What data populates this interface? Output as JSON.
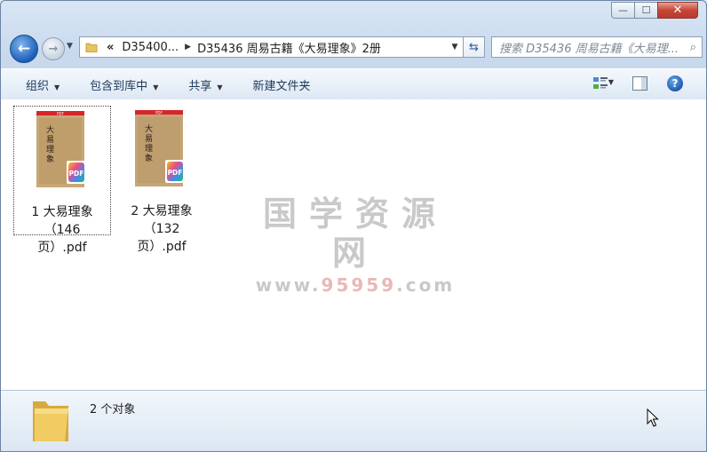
{
  "window": {
    "caption": {
      "minimize": "—",
      "maximize": "☐",
      "close": "✕"
    }
  },
  "nav": {
    "back": "←",
    "forward": "→",
    "breadcrumbs": [
      "D35400...",
      "D35436 周易古籍《大易理象》2册"
    ],
    "overflow": "«",
    "search_placeholder": "搜索 D35436 周易古籍《大易理..."
  },
  "toolbar": {
    "items": [
      {
        "label": "组织",
        "has_menu": true
      },
      {
        "label": "包含到库中",
        "has_menu": true
      },
      {
        "label": "共享",
        "has_menu": true
      },
      {
        "label": "新建文件夹",
        "has_menu": false
      }
    ],
    "help": "?"
  },
  "files": [
    {
      "name": "1 大易理象（146页）.pdf",
      "line1": "1 大易理象（146",
      "line2": "页）.pdf",
      "selected": true,
      "badge": "PDF",
      "top_label": "PDF"
    },
    {
      "name": "2 大易理象（132页）.pdf",
      "line1": "2 大易理象（132",
      "line2": "页）.pdf",
      "selected": false,
      "badge": "PDF",
      "top_label": "PDF"
    }
  ],
  "watermark": {
    "title": "国学资源网",
    "url_prefix": "www.",
    "url_highlight": "95959",
    "url_suffix": ".com"
  },
  "status": {
    "count": "2 个对象"
  },
  "colors": {
    "accent": "#1d5fb8",
    "close": "#c7463a",
    "pdf_red": "#d6262c",
    "window_bg": "#dfe9f5"
  }
}
